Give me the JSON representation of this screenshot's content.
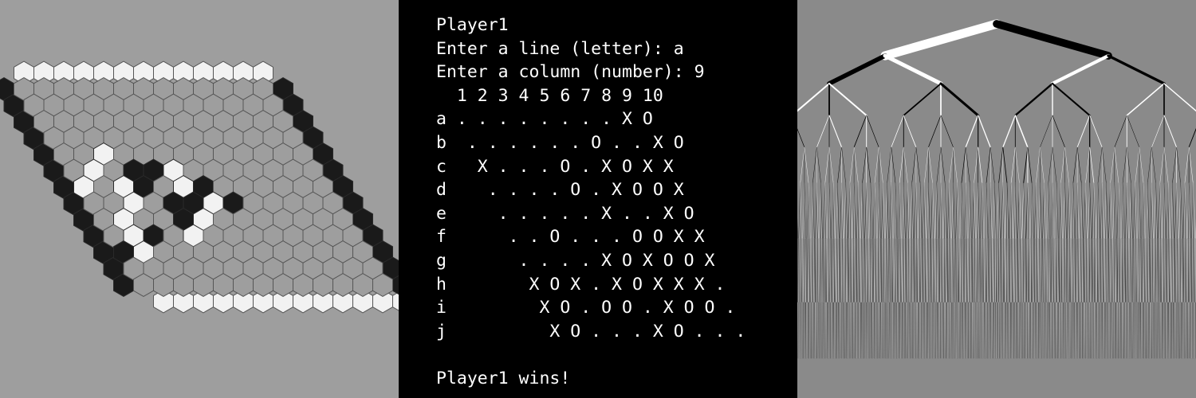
{
  "colors": {
    "hex_background": "#9e9e9e",
    "cell_empty": "#9e9e9e",
    "cell_white": "#f2f2f2",
    "cell_black": "#1a1a1a",
    "cell_border_dark": "#2a2a2a",
    "cell_border_light": "#555555",
    "terminal_background": "#000000",
    "terminal_text": "#ffffff",
    "tree_background": "#8a8a8a",
    "tree_white": "#ffffff",
    "tree_black": "#000000"
  },
  "hex_board": {
    "size": 13,
    "top_edge_color": "white",
    "bottom_edge_color": "white",
    "left_edge_color": "black",
    "right_edge_color": "black",
    "black_stones": [
      [
        5,
        3
      ],
      [
        5,
        4
      ],
      [
        6,
        3
      ],
      [
        6,
        6
      ],
      [
        7,
        4
      ],
      [
        7,
        5
      ],
      [
        7,
        7
      ],
      [
        8,
        4
      ],
      [
        9,
        2
      ],
      [
        10,
        0
      ]
    ],
    "white_stones": [
      [
        4,
        2
      ],
      [
        5,
        1
      ],
      [
        5,
        5
      ],
      [
        6,
        0
      ],
      [
        6,
        2
      ],
      [
        6,
        5
      ],
      [
        7,
        2
      ],
      [
        7,
        6
      ],
      [
        8,
        1
      ],
      [
        8,
        5
      ],
      [
        9,
        1
      ],
      [
        9,
        4
      ],
      [
        10,
        1
      ]
    ]
  },
  "terminal": {
    "lines": [
      "Player1",
      "Enter a line (letter): a",
      "Enter a column (number): 9",
      "  1 2 3 4 5 6 7 8 9 10",
      "a . . . . . . . . X O",
      "b  . . . . . . O . . X O",
      "c   X . . . O . X O X X",
      "d    . . . . O . X O O X",
      "e     . . . . . X . . X O",
      "f      . . O . . . O O X X",
      "g       . . . . X O X O O X",
      "h        X O X . X O X X X .",
      "i         X O . O O . X O O .",
      "j          X O . . . X O . . .",
      "",
      "Player1 wins!"
    ]
  },
  "tree": {
    "depth": 8,
    "branching": [
      2,
      2,
      3,
      3,
      3,
      4,
      4,
      3
    ]
  }
}
